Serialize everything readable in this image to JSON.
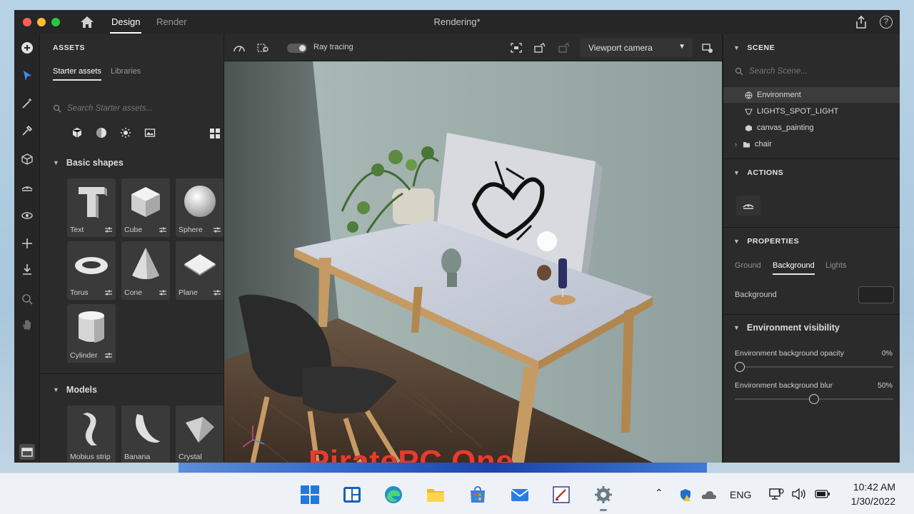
{
  "app": {
    "tabs": [
      {
        "label": "Design",
        "active": true
      },
      {
        "label": "Render",
        "active": false
      }
    ],
    "document_title": "Rendering*",
    "help_label": "?"
  },
  "left_tools": [
    "add-icon",
    "select-icon",
    "magic-wand-icon",
    "eyedropper-icon",
    "cube-icon",
    "horizon-icon",
    "orbit-icon",
    "move-icon",
    "drop-to-ground-icon",
    "zoom-icon",
    "hand-icon",
    "panel-toggle-icon"
  ],
  "assets": {
    "title": "ASSETS",
    "tabs": {
      "starter": "Starter assets",
      "libraries": "Libraries"
    },
    "search_placeholder": "Search Starter assets...",
    "filters": [
      "models-filter-icon",
      "materials-filter-icon",
      "lights-filter-icon",
      "images-filter-icon"
    ],
    "basic_shapes": {
      "header": "Basic shapes",
      "items": [
        {
          "label": "Text"
        },
        {
          "label": "Cube"
        },
        {
          "label": "Sphere"
        },
        {
          "label": "Torus"
        },
        {
          "label": "Cone"
        },
        {
          "label": "Plane"
        },
        {
          "label": "Cylinder"
        }
      ]
    },
    "models": {
      "header": "Models",
      "items": [
        {
          "label": "Mobius strip"
        },
        {
          "label": "Banana"
        },
        {
          "label": "Crystal"
        }
      ]
    }
  },
  "viewport": {
    "ray_tracing_label": "Ray tracing",
    "ray_tracing_on": true,
    "camera_select": "Viewport camera",
    "watermark": "PiratePC.One"
  },
  "scene": {
    "title": "SCENE",
    "search_placeholder": "Search Scene...",
    "items": [
      {
        "label": "Environment",
        "selected": true
      },
      {
        "label": "LIGHTS_SPOT_LIGHT",
        "selected": false
      },
      {
        "label": "canvas_painting",
        "selected": false
      },
      {
        "label": "chair",
        "selected": false
      }
    ]
  },
  "actions": {
    "title": "ACTIONS"
  },
  "properties": {
    "title": "PROPERTIES",
    "tabs": [
      {
        "label": "Ground",
        "active": false
      },
      {
        "label": "Background",
        "active": true
      },
      {
        "label": "Lights",
        "active": false
      }
    ],
    "background_label": "Background",
    "background_color": "#232323",
    "env_visibility": {
      "header": "Environment visibility",
      "opacity_label": "Environment background opacity",
      "opacity_value": "0%",
      "opacity": 0,
      "blur_label": "Environment background blur",
      "blur_value": "50%",
      "blur": 0.5
    }
  },
  "taskbar": {
    "apps": [
      "windows-start-icon",
      "widgets-icon",
      "edge-icon",
      "file-explorer-icon",
      "store-icon",
      "mail-icon",
      "paint-icon",
      "settings-icon"
    ],
    "language": "ENG",
    "time": "10:42 AM",
    "date": "1/30/2022"
  }
}
